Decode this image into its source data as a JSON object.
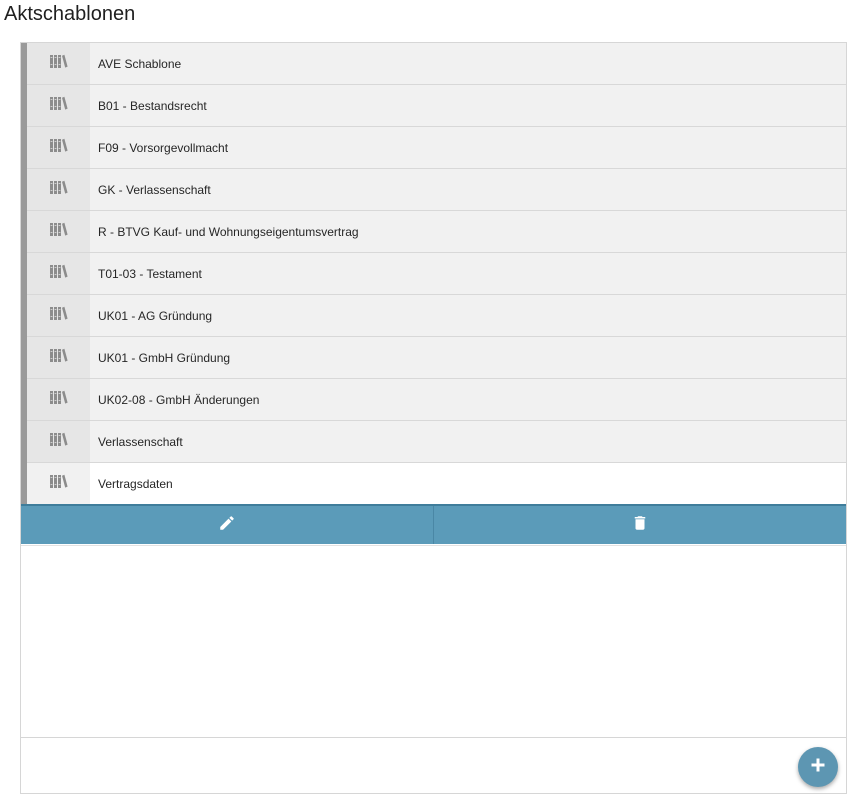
{
  "page": {
    "title": "Aktschablonen"
  },
  "templates": {
    "items": [
      {
        "label": "AVE Schablone",
        "icon": "books-icon"
      },
      {
        "label": "B01 - Bestandsrecht",
        "icon": "books-icon"
      },
      {
        "label": "F09 - Vorsorgevollmacht",
        "icon": "books-icon"
      },
      {
        "label": "GK - Verlassenschaft",
        "icon": "books-icon"
      },
      {
        "label": "R - BTVG Kauf- und Wohnungseigentumsvertrag",
        "icon": "books-icon"
      },
      {
        "label": "T01-03 - Testament",
        "icon": "books-icon"
      },
      {
        "label": "UK01 - AG Gründung",
        "icon": "books-icon"
      },
      {
        "label": "UK01 - GmbH Gründung",
        "icon": "books-icon"
      },
      {
        "label": "UK02-08 - GmbH Änderungen",
        "icon": "books-icon"
      },
      {
        "label": "Verlassenschaft",
        "icon": "books-icon"
      },
      {
        "label": "Vertragsdaten",
        "icon": "books-icon",
        "selected": true
      }
    ]
  },
  "actions": {
    "edit_icon": "pencil-icon",
    "delete_icon": "trash-icon"
  },
  "footer": {
    "add_icon": "plus-icon"
  },
  "colors": {
    "accent": "#5b9bb9",
    "fab": "#5d96b2",
    "row_bg": "#f1f1f1",
    "row_selected_bg": "#ffffff",
    "row_bar": "#9a9a9a"
  }
}
